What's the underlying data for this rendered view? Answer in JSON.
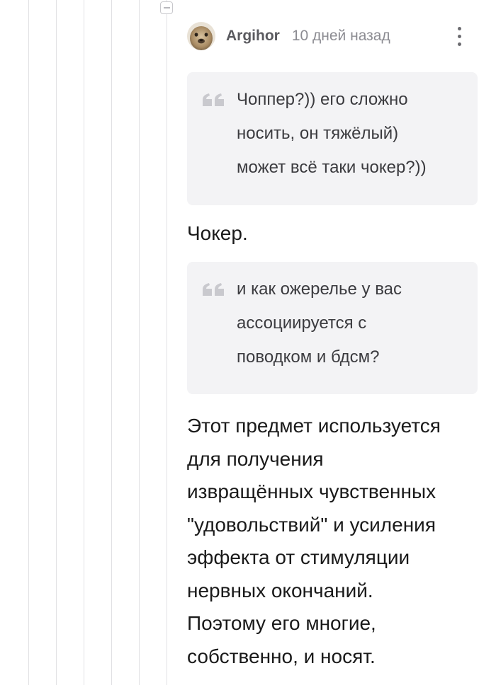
{
  "comment": {
    "author": "Argihor",
    "timestamp": "10 дней назад",
    "avatar_icon": "avatar-seal-icon",
    "menu_icon": "more-vertical-icon",
    "collapse_icon": "collapse-minus-icon",
    "quotes": [
      {
        "icon": "quote-icon",
        "lines": [
          "Чоппер?)) его сложно",
          "носить, он тяжёлый)",
          "может всё таки чокер?))"
        ]
      },
      {
        "icon": "quote-icon",
        "lines": [
          "и как ожерелье у вас",
          "ассоциируется с",
          "поводком и бдсм?"
        ]
      }
    ],
    "reply_short": "Чокер.",
    "reply_long_lines": [
      "Этот предмет используется",
      "для получения",
      "извращённых чувственных",
      "\"удовольствий\" и усиления",
      "эффекта от стимуляции",
      "нервных окончаний.",
      "Поэтому его многие,",
      "собственно, и носят."
    ]
  },
  "colors": {
    "thread_line": "#e1e1e4",
    "quote_background": "#f3f3f5",
    "quote_icon": "#c9c9ce",
    "username": "#5a5a5f",
    "timestamp": "#8c8c92"
  }
}
